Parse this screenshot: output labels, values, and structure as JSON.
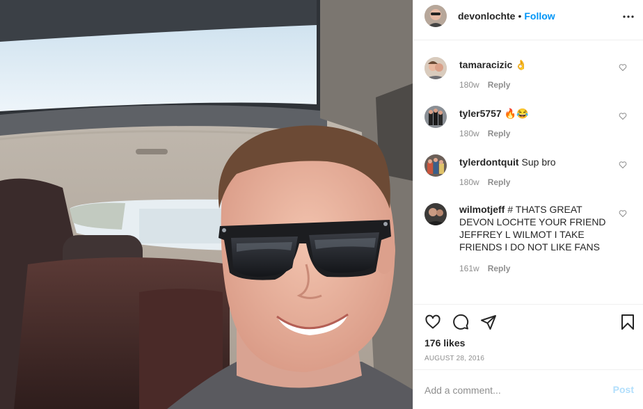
{
  "post": {
    "photo_alt": "Selfie of a man wearing sunglasses inside a car",
    "author": "devonlochte",
    "separator": "•",
    "follow_label": "Follow",
    "more_icon": "more-horizontal-icon"
  },
  "comments": [
    {
      "user": "tamaracizic",
      "text": "👌",
      "age": "180w",
      "reply": "Reply"
    },
    {
      "user": "tyler5757",
      "text": "🔥😂",
      "age": "180w",
      "reply": "Reply"
    },
    {
      "user": "tylerdontquit",
      "text": "Sup bro",
      "age": "180w",
      "reply": "Reply"
    },
    {
      "user": "wilmotjeff",
      "text": "# THATS GREAT DEVON LOCHTE YOUR FRIEND JEFFREY L WILMOT I TAKE FRIENDS I DO NOT LIKE FANS",
      "age": "161w",
      "reply": "Reply"
    }
  ],
  "actions": {
    "like_icon": "heart-icon",
    "comment_icon": "comment-icon",
    "share_icon": "send-icon",
    "save_icon": "bookmark-icon"
  },
  "likes": "176 likes",
  "date": "AUGUST 28, 2016",
  "add_comment": {
    "placeholder": "Add a comment...",
    "post_label": "Post"
  },
  "colors": {
    "accent": "#0095f6",
    "post_disabled": "#b2dffc",
    "muted": "#8e8e8e",
    "divider": "#efefef"
  }
}
